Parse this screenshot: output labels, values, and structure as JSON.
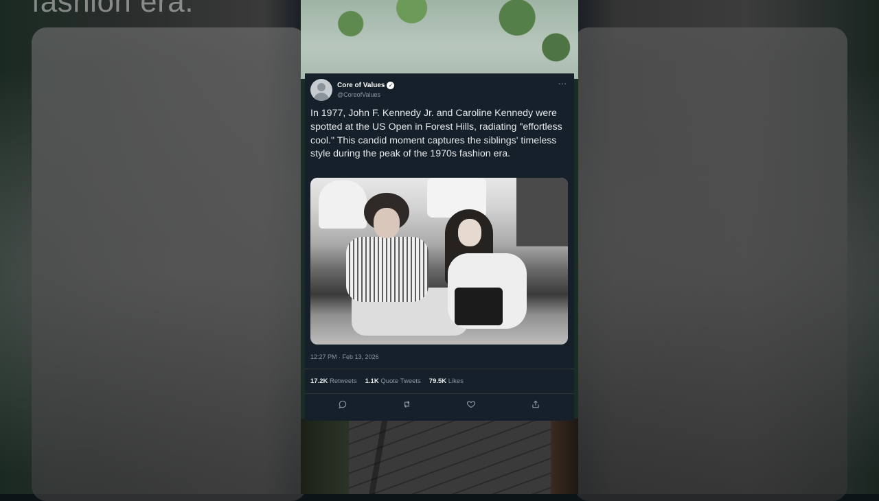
{
  "background": {
    "caption_fragment": "fashion era."
  },
  "tweet": {
    "display_name": "Core of Values",
    "handle": "@CoreofValues",
    "verified_mark": "✓",
    "more_icon": "⋯",
    "text": "In 1977, John F. Kennedy Jr. and Caroline Kennedy were spotted at the US Open in Forest Hills, radiating \"effortless cool.\" This candid moment captures the siblings' timeless style during the peak of the 1970s fashion era.",
    "timestamp": "12:27 PM · Feb 13, 2026",
    "stats": {
      "retweets_count": "17.2K",
      "retweets_label": "Retweets",
      "quotes_count": "1.1K",
      "quotes_label": "Quote Tweets",
      "likes_count": "79.5K",
      "likes_label": "Likes"
    },
    "actions": {
      "reply_icon": "reply-icon",
      "retweet_icon": "retweet-icon",
      "like_icon": "heart-icon",
      "share_icon": "share-icon"
    }
  },
  "colors": {
    "card_bg": "#15202b",
    "text_primary": "#e7e9ea",
    "text_secondary": "#8b98a5"
  }
}
